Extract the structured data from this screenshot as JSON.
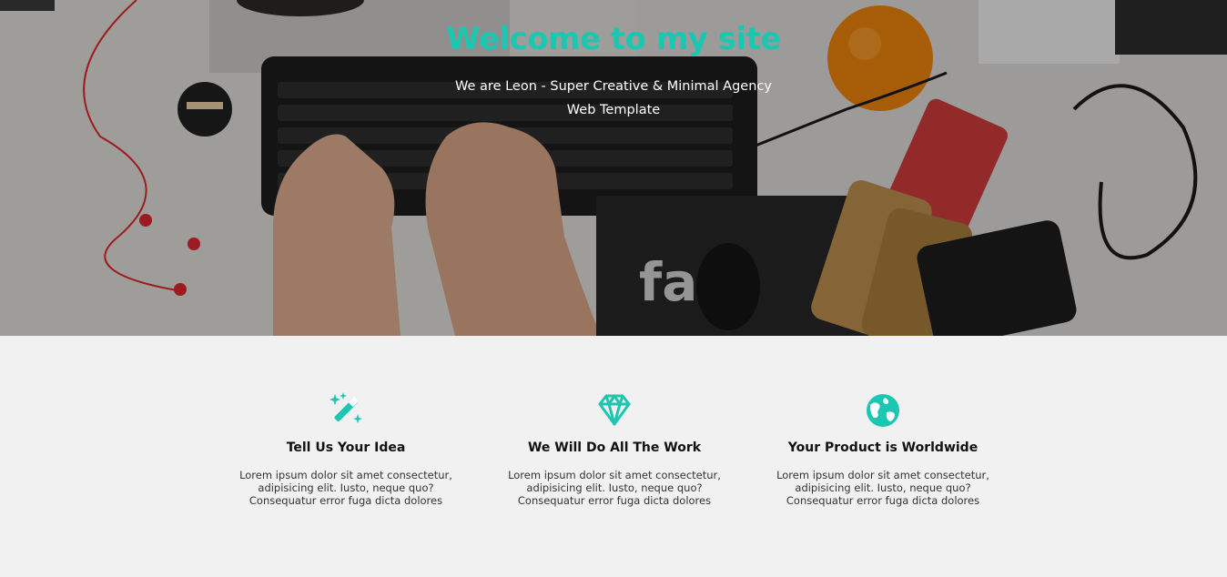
{
  "hero": {
    "title": "Welcome to my site",
    "subtitle": "We are Leon - Super Creative & Minimal Agency Web Template",
    "background_image": "desk-keyboard-photo"
  },
  "colors": {
    "accent": "#1cc7b1",
    "hero_overlay": "#000000",
    "section_bg": "#f1f1f1"
  },
  "features": [
    {
      "icon": "magic-wand-icon",
      "title": "Tell Us Your Idea",
      "text": "Lorem ipsum dolor sit amet consectetur, adipisicing elit. Iusto, neque quo? Consequatur error fuga dicta dolores"
    },
    {
      "icon": "diamond-icon",
      "title": "We Will Do All The Work",
      "text": "Lorem ipsum dolor sit amet consectetur, adipisicing elit. Iusto, neque quo? Consequatur error fuga dicta dolores"
    },
    {
      "icon": "globe-icon",
      "title": "Your Product is Worldwide",
      "text": "Lorem ipsum dolor sit amet consectetur, adipisicing elit. Iusto, neque quo? Consequatur error fuga dicta dolores"
    }
  ]
}
